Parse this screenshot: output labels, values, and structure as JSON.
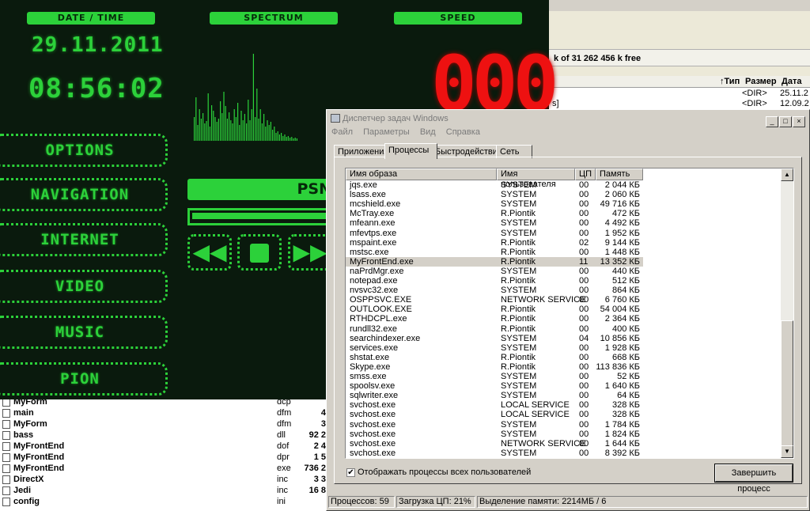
{
  "file_manager": {
    "free_space": "k of 31 262 456 k free",
    "columns": {
      "sort": "↑Тип",
      "size": "Размер",
      "date": "Дата"
    },
    "top_rows": [
      {
        "name": "",
        "size": "<DIR>",
        "date": "25.11.2"
      },
      {
        "name": "s]",
        "size": "<DIR>",
        "date": "12.09.2"
      }
    ],
    "files": [
      {
        "name": "MyForm",
        "ext": "dcp",
        "size": ""
      },
      {
        "name": "main",
        "ext": "dfm",
        "size": "4"
      },
      {
        "name": "MyForm",
        "ext": "dfm",
        "size": "3"
      },
      {
        "name": "bass",
        "ext": "dll",
        "size": "92 2"
      },
      {
        "name": "MyFrontEnd",
        "ext": "dof",
        "size": "2 4"
      },
      {
        "name": "MyFrontEnd",
        "ext": "dpr",
        "size": "1 5"
      },
      {
        "name": "MyFrontEnd",
        "ext": "exe",
        "size": "736 2"
      },
      {
        "name": "DirectX",
        "ext": "inc",
        "size": "3 3"
      },
      {
        "name": "Jedi",
        "ext": "inc",
        "size": "16 8"
      },
      {
        "name": "config",
        "ext": "ini",
        "size": ""
      }
    ]
  },
  "media_app": {
    "date_time_label": "DATE / TIME",
    "spectrum_label": "SPECTRUM",
    "speed_label": "SPEED",
    "date": "29.11.2011",
    "time": "08:56:02",
    "speed_value": "000",
    "station": "PSN",
    "menu": [
      "OPTIONS",
      "NAVIGATION",
      "INTERNET",
      "VIDEO",
      "MUSIC",
      "PION"
    ],
    "colors": {
      "accent": "#2cd13a",
      "speed": "#ee1111",
      "background": "#0a1a0d"
    },
    "controls": [
      "rewind-icon",
      "stop-icon",
      "forward-icon"
    ]
  },
  "task_manager": {
    "title": "Диспетчер задач Windows",
    "window_buttons": [
      "_",
      "□",
      "×"
    ],
    "menu": [
      "Файл",
      "Параметры",
      "Вид",
      "Справка"
    ],
    "tabs": [
      "Приложения",
      "Процессы",
      "Быстродействие",
      "Сеть"
    ],
    "active_tab": "Процессы",
    "columns": [
      "Имя образа",
      "Имя пользователя",
      "ЦП",
      "Память"
    ],
    "processes": [
      {
        "name": "jqs.exe",
        "user": "SYSTEM",
        "cpu": "00",
        "mem": "2 044 КБ"
      },
      {
        "name": "lsass.exe",
        "user": "SYSTEM",
        "cpu": "00",
        "mem": "2 060 КБ"
      },
      {
        "name": "mcshield.exe",
        "user": "SYSTEM",
        "cpu": "00",
        "mem": "49 716 КБ"
      },
      {
        "name": "McTray.exe",
        "user": "R.Piontik",
        "cpu": "00",
        "mem": "472 КБ"
      },
      {
        "name": "mfeann.exe",
        "user": "SYSTEM",
        "cpu": "00",
        "mem": "4 492 КБ"
      },
      {
        "name": "mfevtps.exe",
        "user": "SYSTEM",
        "cpu": "00",
        "mem": "1 952 КБ"
      },
      {
        "name": "mspaint.exe",
        "user": "R.Piontik",
        "cpu": "02",
        "mem": "9 144 КБ"
      },
      {
        "name": "mstsc.exe",
        "user": "R.Piontik",
        "cpu": "00",
        "mem": "1 448 КБ"
      },
      {
        "name": "MyFrontEnd.exe",
        "user": "R.Piontik",
        "cpu": "11",
        "mem": "13 352 КБ",
        "selected": true
      },
      {
        "name": "naPrdMgr.exe",
        "user": "SYSTEM",
        "cpu": "00",
        "mem": "440 КБ"
      },
      {
        "name": "notepad.exe",
        "user": "R.Piontik",
        "cpu": "00",
        "mem": "512 КБ"
      },
      {
        "name": "nvsvc32.exe",
        "user": "SYSTEM",
        "cpu": "00",
        "mem": "864 КБ"
      },
      {
        "name": "OSPPSVC.EXE",
        "user": "NETWORK SERVICE",
        "cpu": "00",
        "mem": "6 760 КБ"
      },
      {
        "name": "OUTLOOK.EXE",
        "user": "R.Piontik",
        "cpu": "00",
        "mem": "54 004 КБ"
      },
      {
        "name": "RTHDCPL.exe",
        "user": "R.Piontik",
        "cpu": "00",
        "mem": "2 364 КБ"
      },
      {
        "name": "rundll32.exe",
        "user": "R.Piontik",
        "cpu": "00",
        "mem": "400 КБ"
      },
      {
        "name": "searchindexer.exe",
        "user": "SYSTEM",
        "cpu": "04",
        "mem": "10 856 КБ"
      },
      {
        "name": "services.exe",
        "user": "SYSTEM",
        "cpu": "00",
        "mem": "1 928 КБ"
      },
      {
        "name": "shstat.exe",
        "user": "R.Piontik",
        "cpu": "00",
        "mem": "668 КБ"
      },
      {
        "name": "Skype.exe",
        "user": "R.Piontik",
        "cpu": "00",
        "mem": "113 836 КБ"
      },
      {
        "name": "smss.exe",
        "user": "SYSTEM",
        "cpu": "00",
        "mem": "52 КБ"
      },
      {
        "name": "spoolsv.exe",
        "user": "SYSTEM",
        "cpu": "00",
        "mem": "1 640 КБ"
      },
      {
        "name": "sqlwriter.exe",
        "user": "SYSTEM",
        "cpu": "00",
        "mem": "64 КБ"
      },
      {
        "name": "svchost.exe",
        "user": "LOCAL SERVICE",
        "cpu": "00",
        "mem": "328 КБ"
      },
      {
        "name": "svchost.exe",
        "user": "LOCAL SERVICE",
        "cpu": "00",
        "mem": "328 КБ"
      },
      {
        "name": "svchost.exe",
        "user": "SYSTEM",
        "cpu": "00",
        "mem": "1 784 КБ"
      },
      {
        "name": "svchost.exe",
        "user": "SYSTEM",
        "cpu": "00",
        "mem": "1 824 КБ"
      },
      {
        "name": "svchost.exe",
        "user": "NETWORK SERVICE",
        "cpu": "00",
        "mem": "1 644 КБ"
      },
      {
        "name": "svchost.exe",
        "user": "SYSTEM",
        "cpu": "00",
        "mem": "8 392 КБ"
      }
    ],
    "show_all_label": "Отображать процессы всех пользователей",
    "show_all_checked": true,
    "end_process_label": "Завершить процесс",
    "status": {
      "processes": "Процессов: 59",
      "cpu": "Загрузка ЦП: 21%",
      "memory": "Выделение памяти: 2214МБ / 6"
    }
  }
}
